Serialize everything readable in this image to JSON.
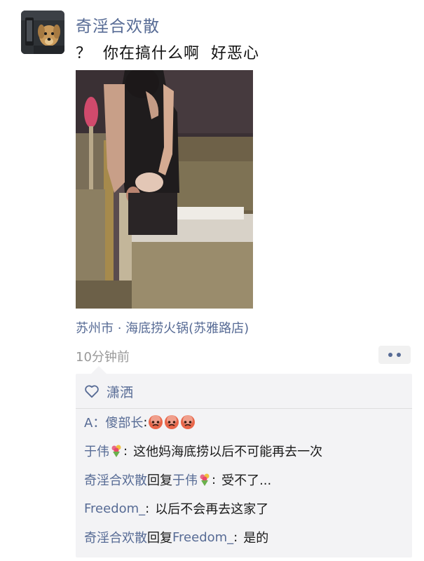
{
  "post": {
    "username": "奇淫合欢散",
    "text": "？  你在搞什么啊  好恶心",
    "location": "苏州市 · 海底捞火锅(苏雅路店)",
    "time": "10分钟前"
  },
  "likes": {
    "names": "潇洒"
  },
  "comments": [
    {
      "author": "A：傻部长",
      "sep": ":",
      "text": ""
    },
    {
      "author": "于伟",
      "sep": ":",
      "text": "这他妈海底捞以后不可能再去一次"
    },
    {
      "author": "奇淫合欢散",
      "reply_word": "回复",
      "target": "于伟",
      "sep": ":",
      "text": "受不了..."
    },
    {
      "author": "Freedom_",
      "sep": ":",
      "text": "以后不会再去这家了"
    },
    {
      "author": "奇淫合欢散",
      "reply_word": "回复",
      "target": "Freedom_",
      "sep": ":",
      "text": "是的"
    }
  ],
  "colors": {
    "link": "#576b95",
    "comment_bg": "#f3f3f5",
    "time": "#999999"
  }
}
